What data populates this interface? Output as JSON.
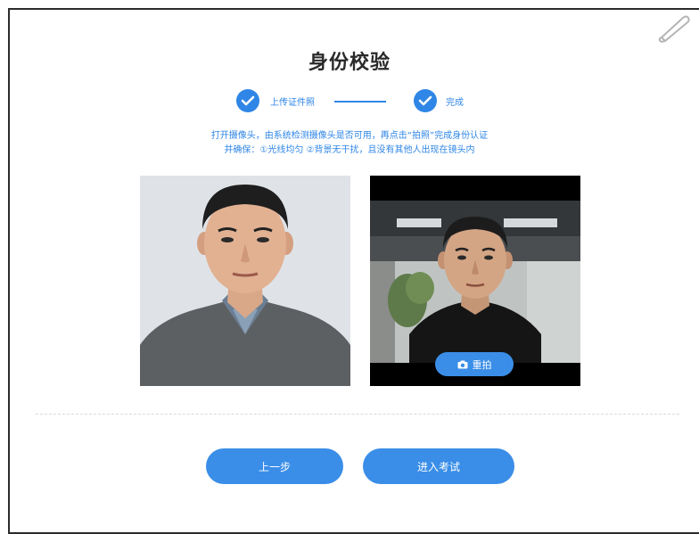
{
  "page": {
    "title": "身份校验",
    "steps": [
      {
        "label": "上传证件照"
      },
      {
        "label": "完成"
      }
    ],
    "instructions": [
      "打开摄像头，由系统检测摄像头是否可用，再点击“拍照”完成身份认证",
      "并确保：①光线均匀 ②背景无干扰，且没有其他人出现在镜头内"
    ],
    "retake_label": "重拍",
    "buttons": {
      "prev_label": "上一步",
      "start_label": "进入考试"
    }
  },
  "icons": {
    "corner": "pen-icon",
    "step_done": "check-icon",
    "camera": "camera-icon"
  },
  "colors": {
    "accent": "#2f86e6",
    "button": "#3a8ee8"
  }
}
